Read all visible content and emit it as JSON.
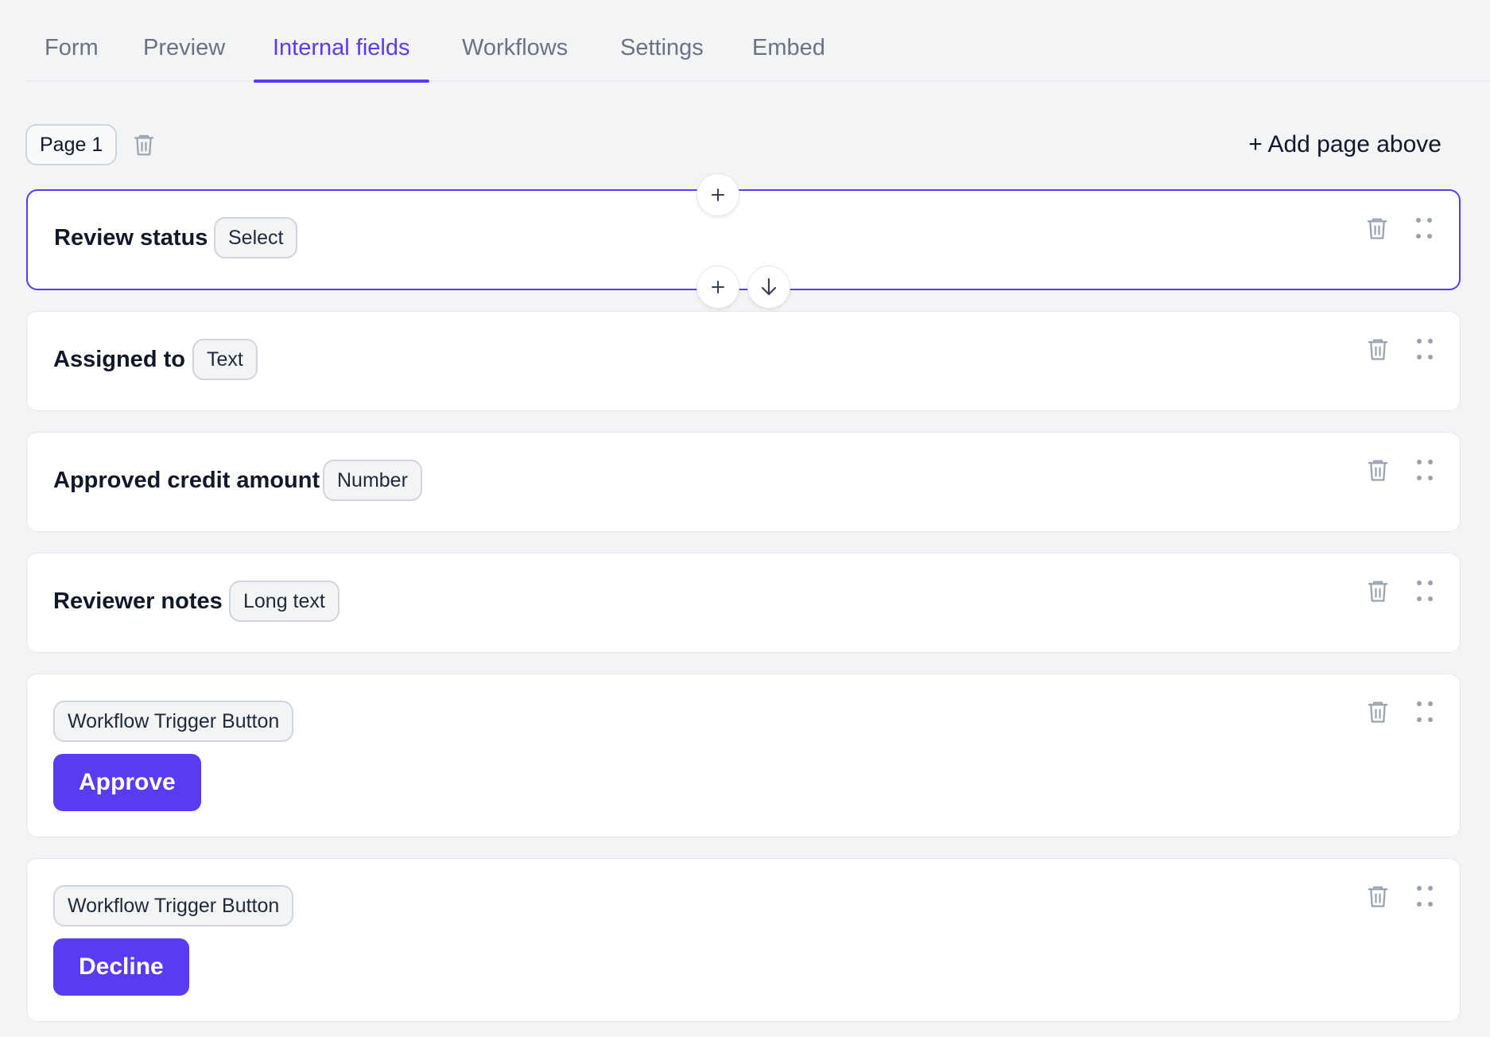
{
  "tabs": [
    {
      "label": "Form",
      "active": false
    },
    {
      "label": "Preview",
      "active": false
    },
    {
      "label": "Internal fields",
      "active": true
    },
    {
      "label": "Workflows",
      "active": false
    },
    {
      "label": "Settings",
      "active": false
    },
    {
      "label": "Embed",
      "active": false
    }
  ],
  "page": {
    "label": "Page 1",
    "add_page_label": "+ Add page above"
  },
  "fields": [
    {
      "label": "Review status",
      "type": "Select",
      "selected": true
    },
    {
      "label": "Assigned to",
      "type": "Text"
    },
    {
      "label": "Approved credit amount",
      "type": "Number"
    },
    {
      "label": "Reviewer notes",
      "type": "Long text"
    }
  ],
  "triggers": [
    {
      "type": "Workflow Trigger Button",
      "button_label": "Approve"
    },
    {
      "type": "Workflow Trigger Button",
      "button_label": "Decline"
    }
  ],
  "colors": {
    "accent": "#5b3bf0",
    "background": "#f3f4f6",
    "card": "#ffffff",
    "border": "#e5e7eb",
    "muted_text": "#6b7280"
  },
  "icons": {
    "trash": "trash-icon",
    "drag": "drag-handle-icon",
    "plus": "plus-icon",
    "arrow_down": "arrow-down-icon"
  }
}
